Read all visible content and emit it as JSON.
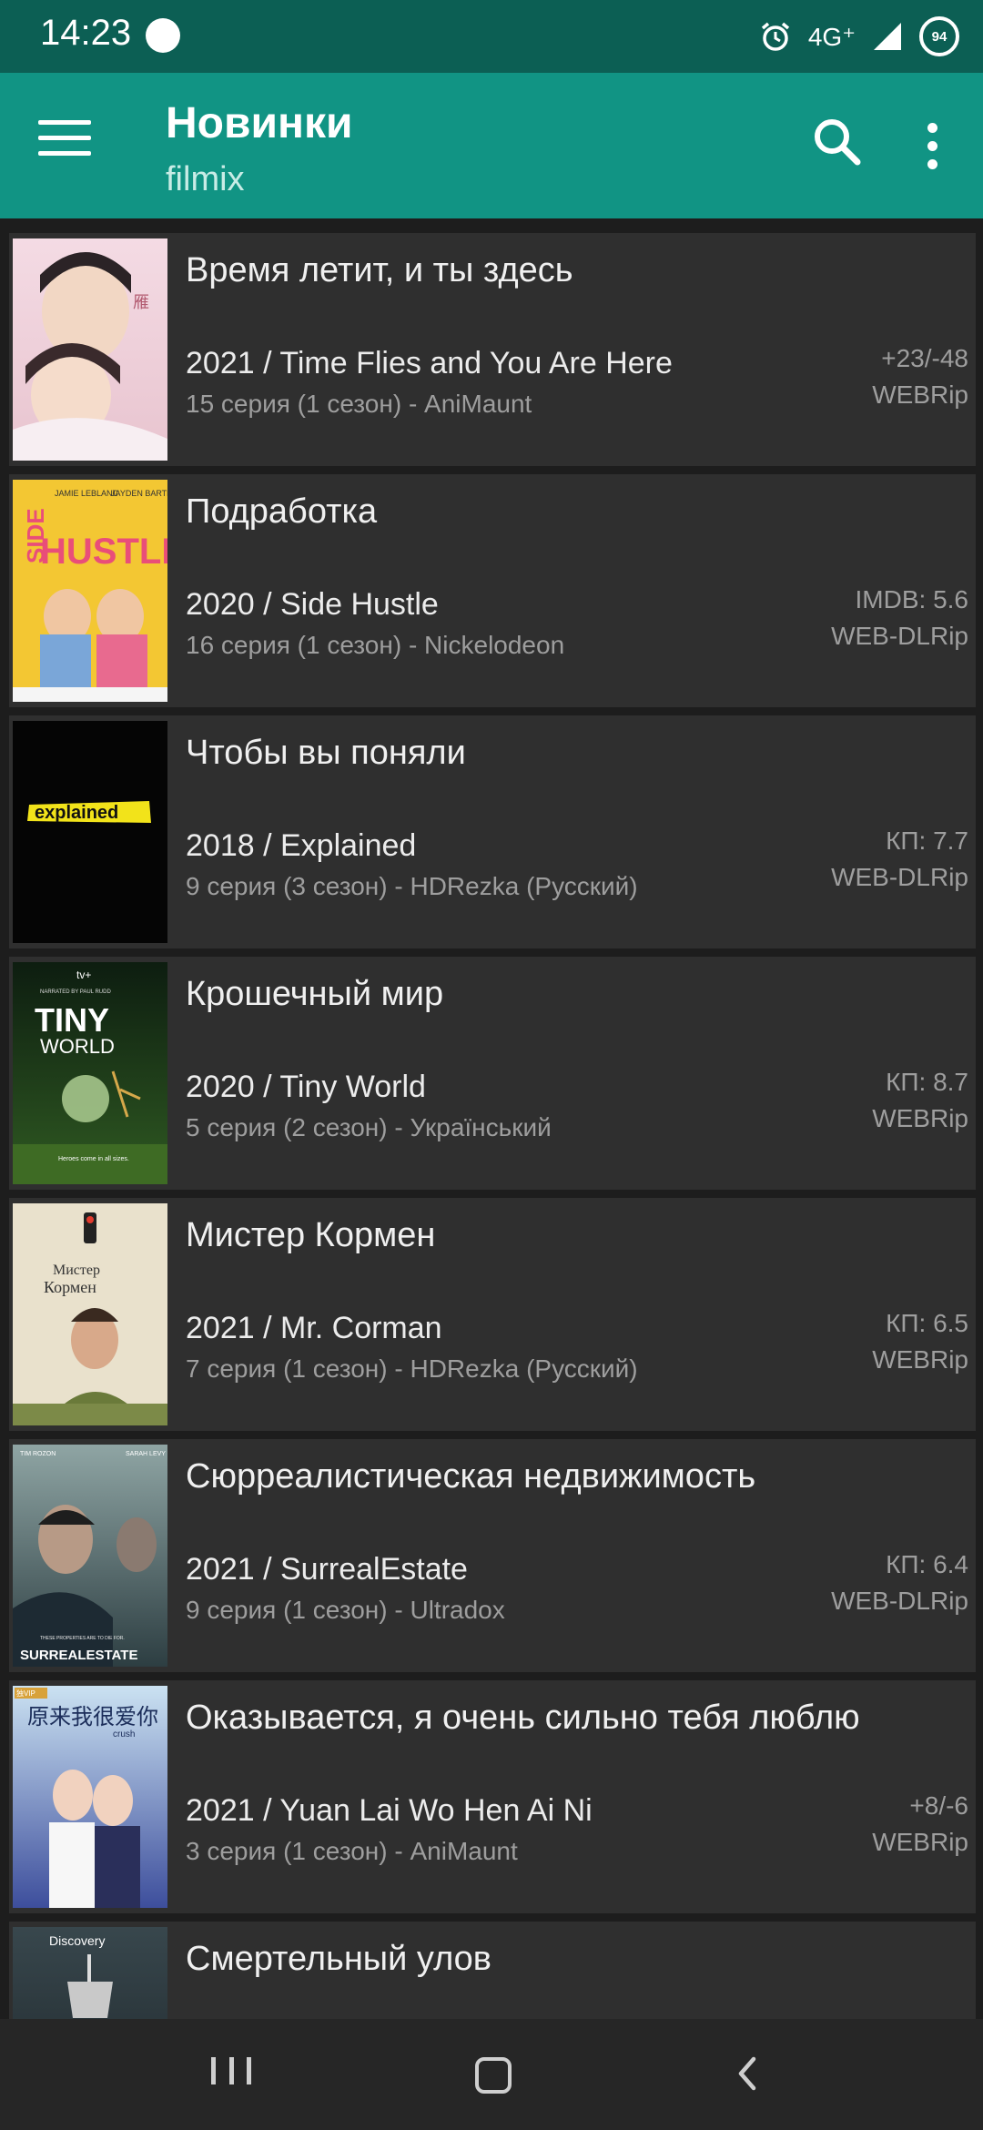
{
  "status_bar": {
    "time": "14:23",
    "network": "4G⁺",
    "battery": "94"
  },
  "app_bar": {
    "title": "Новинки",
    "subtitle": "filmix"
  },
  "items": [
    {
      "title": "Время летит, и ты здесь",
      "line1": "2021 / Time Flies and You Are Here",
      "line2": "15 серия (1 сезон) - AniMaunt",
      "rating": "+23/-48",
      "quality": "WEBRip"
    },
    {
      "title": "Подработка",
      "line1": "2020 / Side Hustle",
      "line2": "16 серия (1 сезон) - Nickelodeon",
      "rating": "IMDB: 5.6",
      "quality": "WEB-DLRip"
    },
    {
      "title": "Чтобы вы поняли",
      "line1": "2018 / Explained",
      "line2": "9 серия (3 сезон) - HDRezka (Русский)",
      "rating": "КП: 7.7",
      "quality": "WEB-DLRip"
    },
    {
      "title": "Крошечный мир",
      "line1": "2020 / Tiny World",
      "line2": "5 серия (2 сезон) - Український",
      "rating": "КП: 8.7",
      "quality": "WEBRip"
    },
    {
      "title": "Мистер Кормен",
      "line1": "2021 / Mr. Corman",
      "line2": "7 серия (1 сезон) - HDRezka (Русский)",
      "rating": "КП: 6.5",
      "quality": "WEBRip"
    },
    {
      "title": "Сюрреалистическая недвижимость",
      "line1": "2021 / SurrealEstate",
      "line2": "9 серия (1 сезон) - Ultradox",
      "rating": "КП: 6.4",
      "quality": "WEB-DLRip"
    },
    {
      "title": "Оказывается, я очень сильно тебя люблю",
      "line1": "2021 / Yuan Lai Wo Hen Ai Ni",
      "line2": "3 серия (1 сезон) - AniMaunt",
      "rating": "+8/-6",
      "quality": "WEBRip"
    },
    {
      "title": "Смертельный улов",
      "line1": "",
      "line2": "",
      "rating": "",
      "quality": ""
    }
  ],
  "posters": {
    "side_hustle": {
      "top": "SIDE",
      "main": "HUSTLE",
      "credit1": "JAMIE LEBLANC",
      "credit2": "JAYDEN BARTELS"
    },
    "explained": {
      "text": "explained"
    },
    "tiny_world": {
      "brand": "tv+",
      "top": "NARRATED BY PAUL RUDD",
      "main": "TINY",
      "sub": "WORLD",
      "tagline": "Heroes come in all sizes."
    },
    "mr_corman": {
      "line1": "Мистер",
      "line2": "Кормен"
    },
    "surreal": {
      "credit1": "TIM ROZON",
      "credit2": "SARAH LEVY",
      "tagline": "THESE PROPERTIES ARE TO DIE FOR.",
      "title": "SURREALESTATE"
    },
    "yuan_lai": {
      "badge": "独VIP",
      "chinese": "原来我很爱你",
      "english": "crush"
    },
    "discovery": {
      "brand": "Discovery"
    }
  },
  "colors": {
    "status_bar": "#0c5f54",
    "app_bar": "#119484",
    "card": "#2f2f2f",
    "background": "#1d1d1d",
    "nav_bar": "#262626"
  }
}
